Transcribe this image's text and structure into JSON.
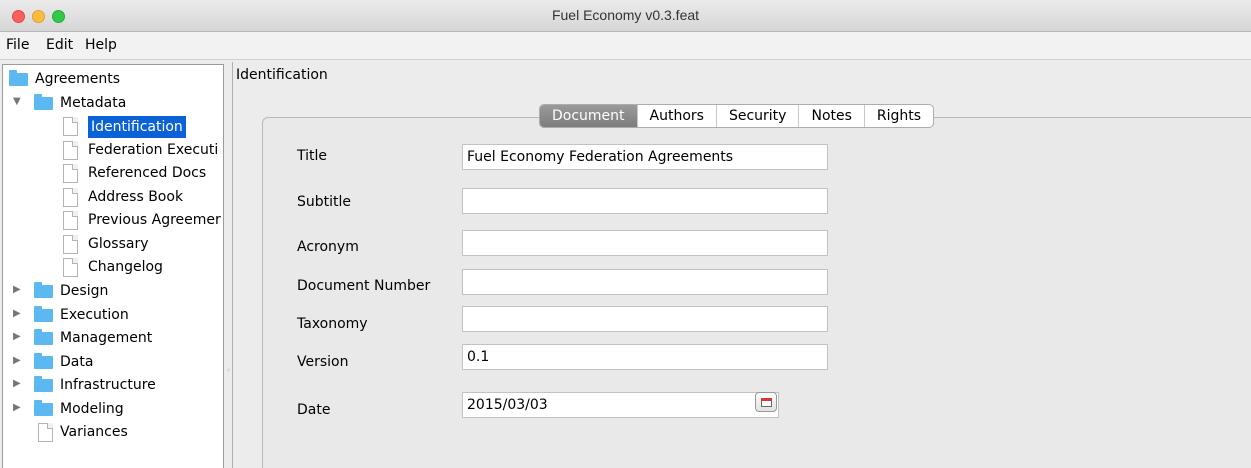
{
  "window": {
    "title": "Fuel Economy v0.3.feat"
  },
  "menu": [
    "File",
    "Edit",
    "Help"
  ],
  "tree": {
    "root": "Agreements",
    "metadata": {
      "label": "Metadata",
      "children": [
        "Identification",
        "Federation Executi",
        "Referenced Docs",
        "Address Book",
        "Previous Agreemer",
        "Glossary",
        "Changelog"
      ]
    },
    "folders": [
      "Design",
      "Execution",
      "Management",
      "Data",
      "Infrastructure",
      "Modeling"
    ],
    "variances": "Variances"
  },
  "main": {
    "section_title": "Identification",
    "tabs": [
      "Document",
      "Authors",
      "Security",
      "Notes",
      "Rights"
    ],
    "active_tab": "Document",
    "fields": {
      "title": {
        "label": "Title",
        "value": "Fuel Economy Federation Agreements"
      },
      "subtitle": {
        "label": "Subtitle",
        "value": ""
      },
      "acronym": {
        "label": "Acronym",
        "value": ""
      },
      "document_number": {
        "label": "Document Number",
        "value": ""
      },
      "taxonomy": {
        "label": "Taxonomy",
        "value": ""
      },
      "version": {
        "label": "Version",
        "value": "0.1"
      },
      "date": {
        "label": "Date",
        "value": "2015/03/03"
      }
    }
  },
  "icons": {
    "folder": "folder-icon",
    "document": "document-icon",
    "calendar": "calendar-icon"
  }
}
